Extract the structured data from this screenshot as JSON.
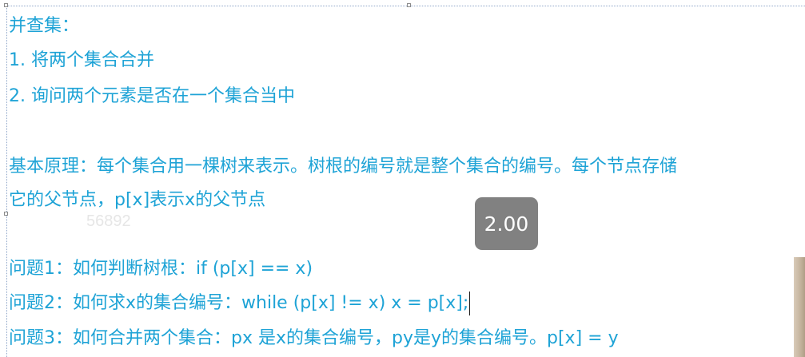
{
  "lines": {
    "title": "并查集：",
    "item1": "1. 将两个集合合并",
    "item2": "2. 询问两个元素是否在一个集合当中",
    "principle1": "基本原理：每个集合用一棵树来表示。树根的编号就是整个集合的编号。每个节点存储",
    "principle2": "它的父节点，p[x]表示x的父节点",
    "q1": "问题1：如何判断树根：if (p[x] == x)",
    "q2": "问题2：如何求x的集合编号：while (p[x] != x) x = p[x];",
    "q3": "问题3：如何合并两个集合：px 是x的集合编号，py是y的集合编号。p[x] = y"
  },
  "watermark": "56892",
  "playback_speed": "2.00",
  "colors": {
    "text": "#1ea3d6",
    "badge_bg": "#767676",
    "frame": "#8fa6c9"
  }
}
